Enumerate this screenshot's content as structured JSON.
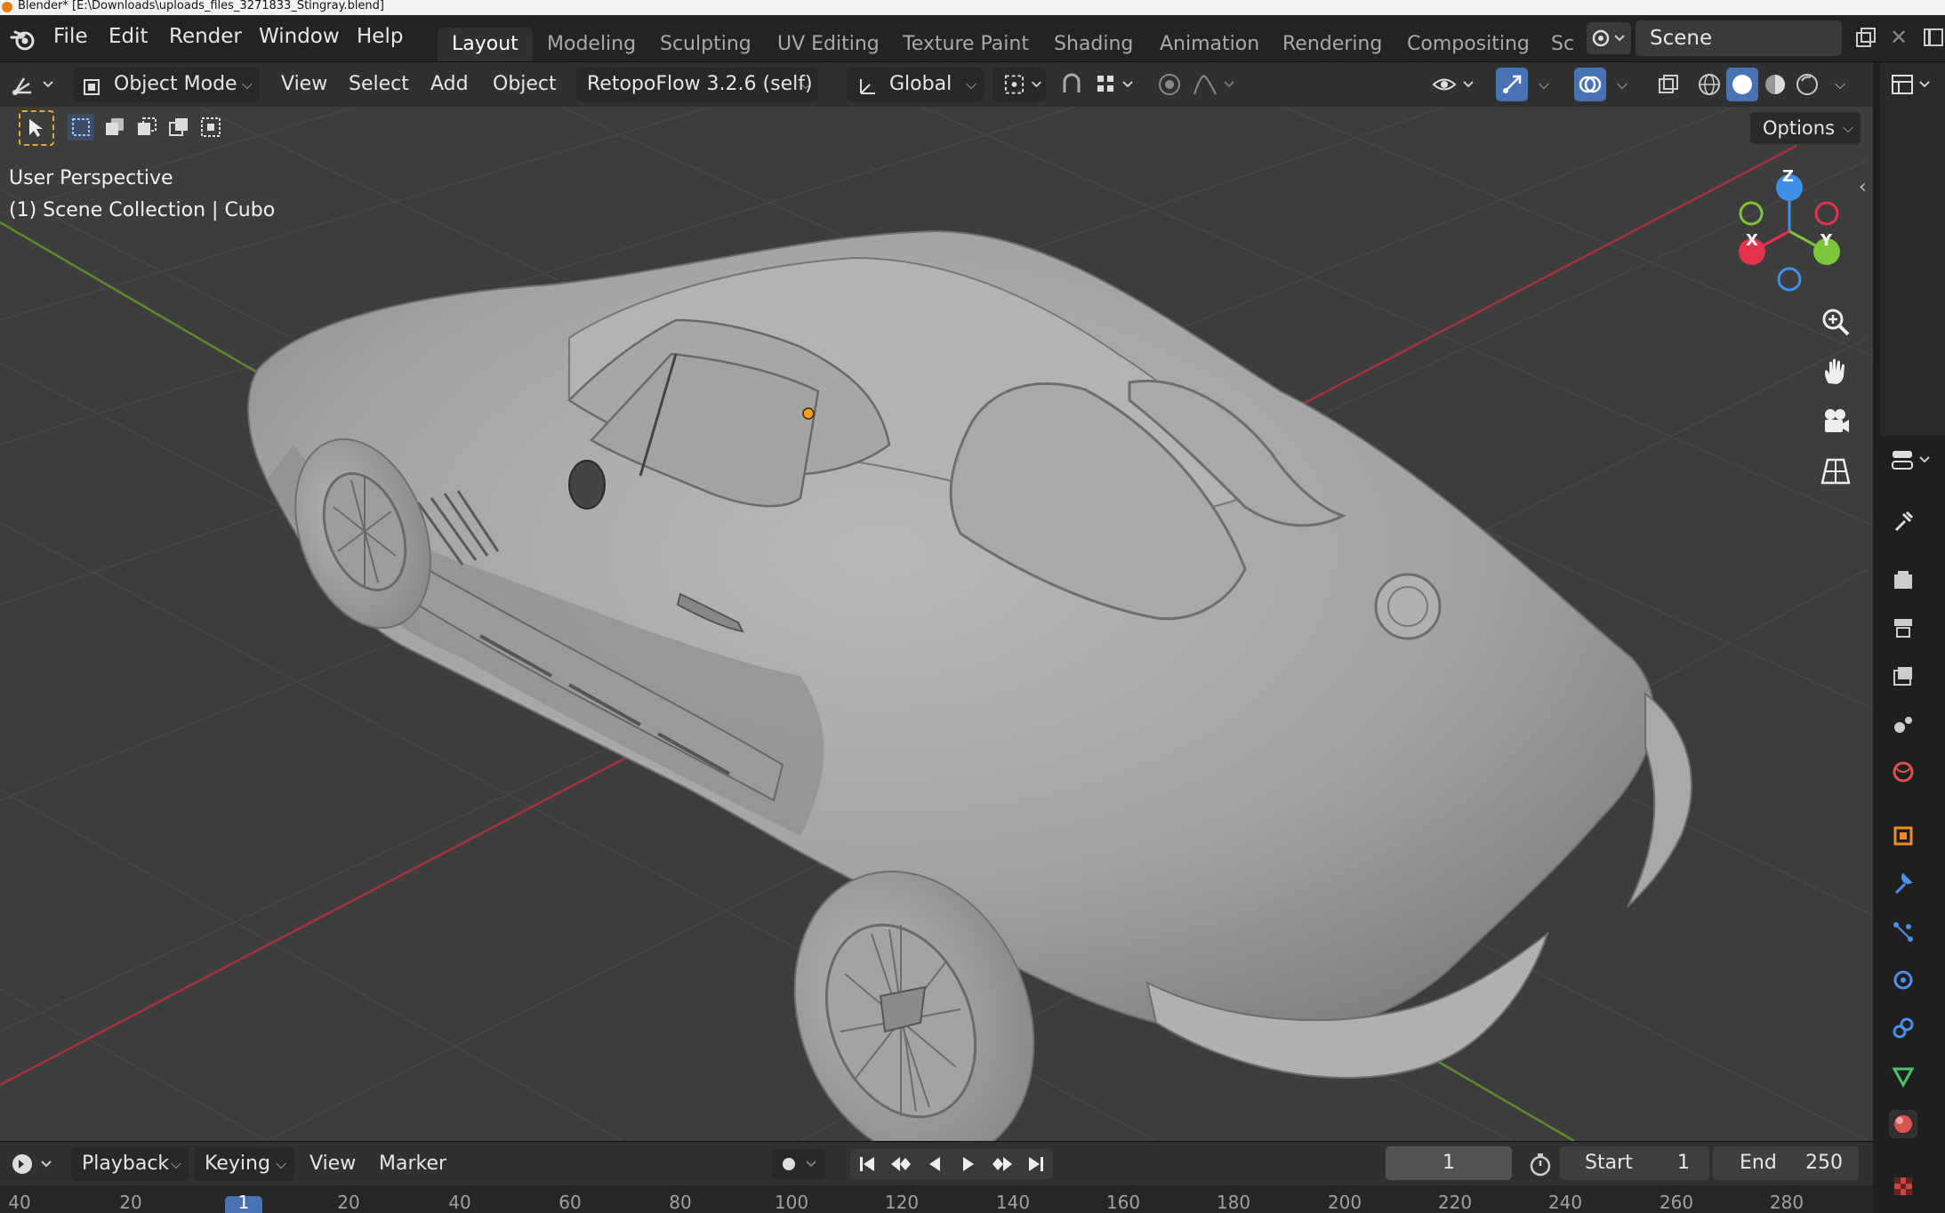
{
  "window": {
    "title": "Blender* [E:\\Downloads\\uploads_files_3271833_Stingray.blend]"
  },
  "menus": [
    "File",
    "Edit",
    "Render",
    "Window",
    "Help"
  ],
  "workspaces": [
    "Layout",
    "Modeling",
    "Sculpting",
    "UV Editing",
    "Texture Paint",
    "Shading",
    "Animation",
    "Rendering",
    "Compositing",
    "Sc"
  ],
  "active_workspace": "Layout",
  "scene": {
    "name": "Scene"
  },
  "header": {
    "mode": "Object Mode",
    "menus": [
      "View",
      "Select",
      "Add",
      "Object"
    ],
    "addon": "RetopoFlow 3.2.6 (self)",
    "transform_orientation": "Global",
    "options_label": "Options"
  },
  "viewport": {
    "view_name": "User Perspective",
    "collection_info": "(1) Scene Collection | Cubo",
    "gizmo_axes": [
      "Z",
      "Y",
      "X"
    ]
  },
  "timeline": {
    "menus": [
      "Playback",
      "Keying",
      "View",
      "Marker"
    ],
    "current_frame": "1",
    "start_label": "Start",
    "start_value": "1",
    "end_label": "End",
    "end_value": "250",
    "ruler_marks": [
      "40",
      "20",
      "1",
      "20",
      "40",
      "60",
      "80",
      "100",
      "120",
      "140",
      "160",
      "180",
      "200",
      "220",
      "240",
      "260",
      "280"
    ]
  },
  "colors": {
    "accent_blue": "#4772b3",
    "axis_x": "#e5334e",
    "axis_y": "#7cc63a",
    "axis_z": "#3d8fe8",
    "grid_floor": "#3d3d3d",
    "origin_dot": "#f0a020"
  },
  "icons": {
    "blender_logo": "blender-logo-icon",
    "editor_type": "3d-viewport-editor-icon",
    "zoom": "zoom-icon",
    "pan": "hand-pan-icon",
    "camera": "camera-view-icon",
    "ortho": "grid-perspective-icon"
  }
}
